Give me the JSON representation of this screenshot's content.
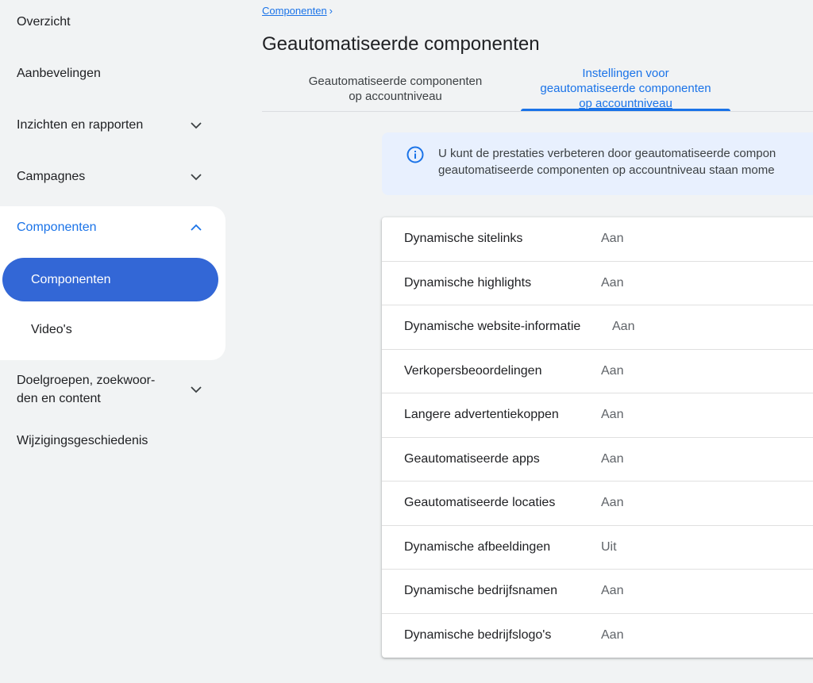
{
  "sidebar": {
    "overview": "Overzicht",
    "recommendations": "Aanbevelingen",
    "insights": "Inzichten en rapporten",
    "campaigns": "Campagnes",
    "assets_group": "Componenten",
    "assets_sub_active": "Componenten",
    "videos": "Video's",
    "audiences_line1": "Doelgroepen, zoekwoor-",
    "audiences_line2": "den en content",
    "change_history": "Wijzigingsgeschiedenis"
  },
  "breadcrumb": {
    "parent": "Componenten",
    "separator": "›"
  },
  "page": {
    "title": "Geautomatiseerde componenten"
  },
  "tabs": {
    "tab1_line1": "Geautomatiseerde componenten",
    "tab1_line2": "op accountniveau",
    "tab2_line1": "Instellingen voor",
    "tab2_line2": "geautomatiseerde componenten",
    "tab2_line3": "op accountniveau"
  },
  "banner": {
    "line1": "U kunt de prestaties verbeteren door geautomatiseerde compon",
    "line2": "geautomatiseerde componenten op accountniveau staan mome"
  },
  "settings": [
    {
      "name": "Dynamische sitelinks",
      "status": "Aan"
    },
    {
      "name": "Dynamische highlights",
      "status": "Aan"
    },
    {
      "name": "Dynamische website-informatie",
      "status": "Aan"
    },
    {
      "name": "Verkopersbeoordelingen",
      "status": "Aan"
    },
    {
      "name": "Langere advertentiekoppen",
      "status": "Aan"
    },
    {
      "name": "Geautomatiseerde apps",
      "status": "Aan"
    },
    {
      "name": "Geautomatiseerde locaties",
      "status": "Aan"
    },
    {
      "name": "Dynamische afbeeldingen",
      "status": "Uit"
    },
    {
      "name": "Dynamische bedrijfsnamen",
      "status": "Aan"
    },
    {
      "name": "Dynamische bedrijfslogo's",
      "status": "Aan"
    }
  ],
  "colors": {
    "accent": "#1a73e8",
    "active_pill": "#3367d6",
    "banner_bg": "#e8f0fe",
    "page_bg": "#f1f3f4"
  },
  "icons": {
    "info": "info-icon",
    "chevron_down": "chevron-down-icon",
    "chevron_up": "chevron-up-icon"
  }
}
